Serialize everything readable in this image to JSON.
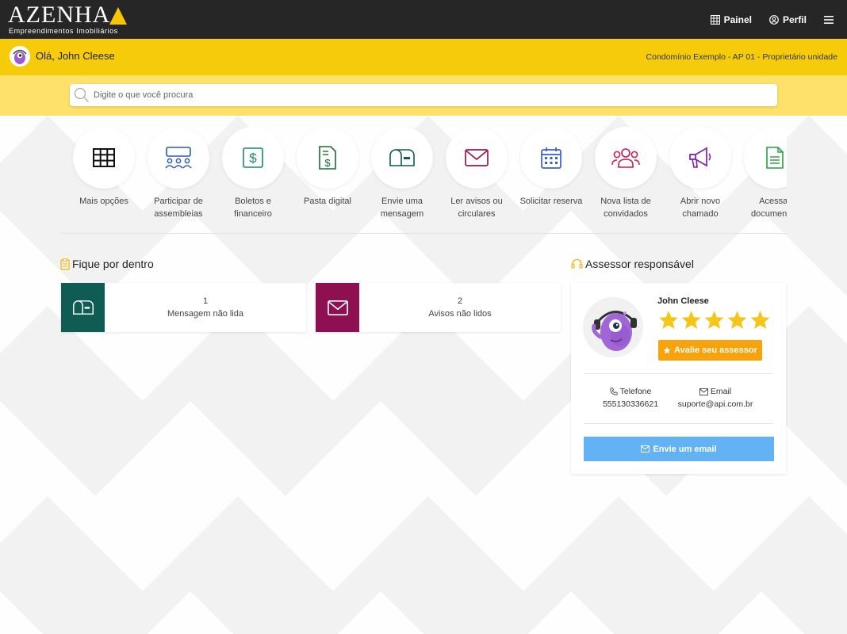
{
  "brand": {
    "title": "AZENHA",
    "subtitle": "Empreendimentos Imobiliários"
  },
  "nav": {
    "panel_label": "Painel",
    "profile_label": "Perfil",
    "menu_icon": "hamburger-menu-icon"
  },
  "greeting": {
    "text": "Olá, John Cleese",
    "unit": "Condomínio Exemplo - AP 01 - Proprietário unidade"
  },
  "search": {
    "placeholder": "Digite o que você procura",
    "value": ""
  },
  "shortcuts": [
    {
      "label": "Mais opções",
      "icon": "grid-icon",
      "color": "#111111"
    },
    {
      "label": "Participar de assembleias",
      "icon": "assembly-icon",
      "color": "#2b5ab8"
    },
    {
      "label": "Boletos e financeiro",
      "icon": "dollar-icon",
      "color": "#1a8a6d"
    },
    {
      "label": "Pasta digital",
      "icon": "document-dollar-icon",
      "color": "#1e6b34"
    },
    {
      "label": "Envie uma mensagem",
      "icon": "mailbox-icon",
      "color": "#0e5a53"
    },
    {
      "label": "Ler avisos ou circulares",
      "icon": "envelope-icon",
      "color": "#9c1450"
    },
    {
      "label": "Solicitar reserva",
      "icon": "calendar-icon",
      "color": "#3d5fc7"
    },
    {
      "label": "Nova lista de convidados",
      "icon": "users-icon",
      "color": "#d4164e"
    },
    {
      "label": "Abrir novo chamado",
      "icon": "megaphone-icon",
      "color": "#7e1fa8"
    },
    {
      "label": "Acessar documentos",
      "icon": "file-text-icon",
      "color": "#21a242"
    }
  ],
  "news": {
    "heading": "Fique por dentro",
    "cards": [
      {
        "count": "1",
        "text": "Mensagem não lida",
        "color": "#0f5c54"
      },
      {
        "count": "2",
        "text": "Avisos não lidos",
        "color": "#8e1052"
      }
    ]
  },
  "advisor": {
    "heading": "Assessor responsável",
    "name": "John Cleese",
    "rating": 5,
    "rating_max": 5,
    "rate_label": "Avalie seu assessor",
    "phone_label": "Telefone",
    "phone": "555130336621",
    "email_label": "Email",
    "email": "suporte@api.com.br",
    "email_button": "Envie um email"
  },
  "colors": {
    "topbar": "#262626",
    "greeting_bar": "#f6cc0a",
    "search_bar": "#fde16a",
    "accent_orange": "#f8a30b",
    "email_button": "#63b3f4"
  }
}
